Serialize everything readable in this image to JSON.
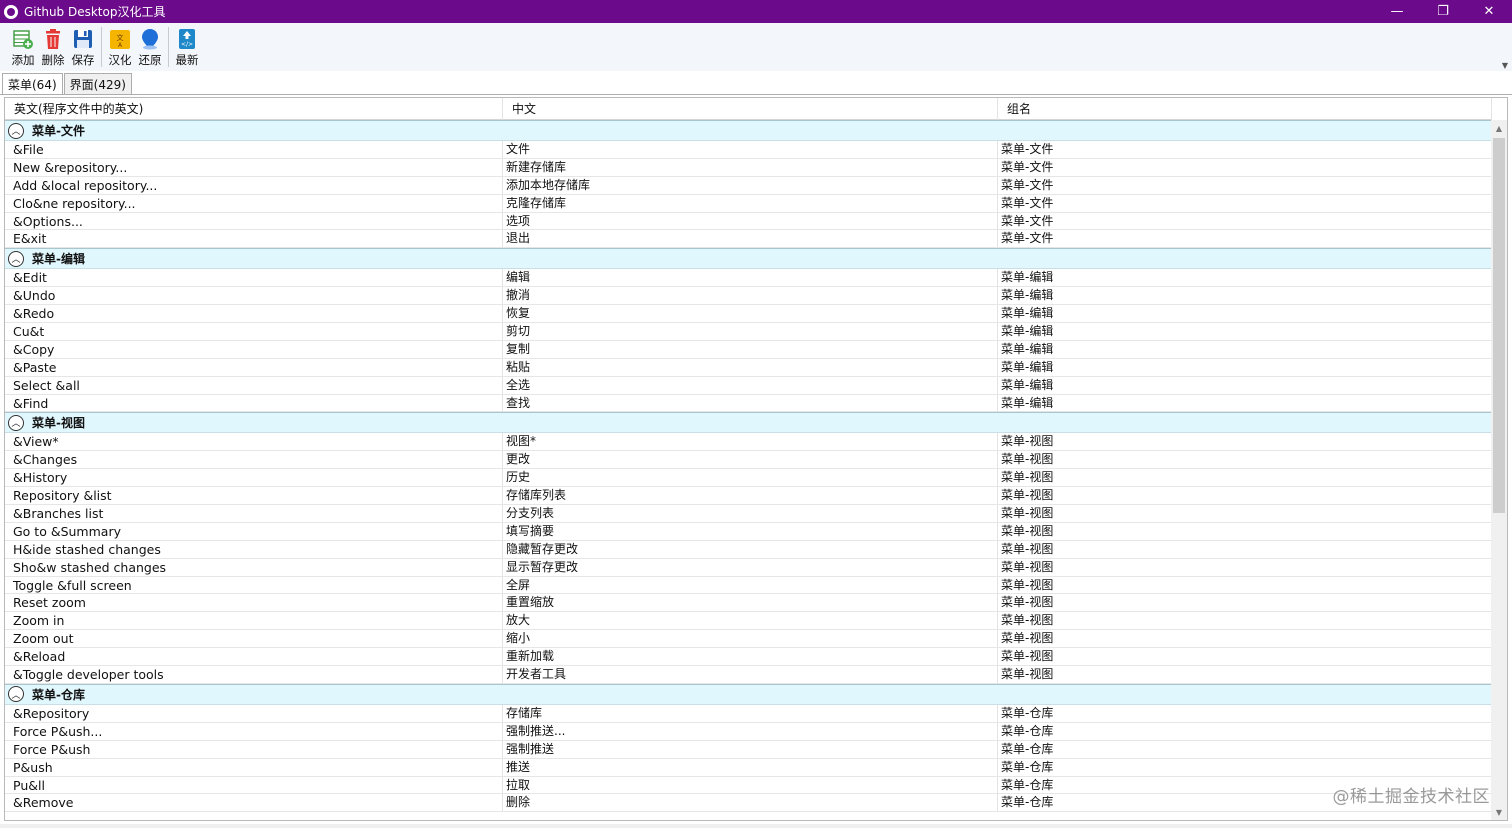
{
  "window": {
    "title": "Github Desktop汉化工具",
    "controls": [
      "—",
      "❐",
      "✕"
    ]
  },
  "toolbar": {
    "buttons": [
      {
        "label": "添加",
        "icon": "add-table-icon",
        "color": "#4caf50"
      },
      {
        "label": "删除",
        "icon": "trash-icon",
        "color": "#e53935"
      },
      {
        "label": "保存",
        "icon": "save-disk-icon",
        "color": "#1e5fb3"
      },
      {
        "label": "汉化",
        "icon": "translate-icon",
        "color": "#f5b400"
      },
      {
        "label": "还原",
        "icon": "restore-pin-icon",
        "color": "#1e6fd8"
      },
      {
        "label": "最新",
        "icon": "update-icon",
        "color": "#1e88c8"
      }
    ]
  },
  "tabs": [
    {
      "label": "菜单(64)",
      "active": true
    },
    {
      "label": "界面(429)",
      "active": false
    }
  ],
  "grid": {
    "headers": [
      "英文(程序文件中的英文)",
      "中文",
      "组名"
    ],
    "groups": [
      {
        "name": "菜单-文件",
        "rows": [
          [
            "&File",
            "文件",
            "菜单-文件"
          ],
          [
            "New &repository...",
            "新建存储库",
            "菜单-文件"
          ],
          [
            "Add &local repository...",
            "添加本地存储库",
            "菜单-文件"
          ],
          [
            "Clo&ne repository...",
            "克隆存储库",
            "菜单-文件"
          ],
          [
            "&Options...",
            "选项",
            "菜单-文件"
          ],
          [
            "E&xit",
            "退出",
            "菜单-文件"
          ]
        ]
      },
      {
        "name": "菜单-编辑",
        "rows": [
          [
            "&Edit",
            "编辑",
            "菜单-编辑"
          ],
          [
            "&Undo",
            "撤消",
            "菜单-编辑"
          ],
          [
            "&Redo",
            "恢复",
            "菜单-编辑"
          ],
          [
            "Cu&t",
            "剪切",
            "菜单-编辑"
          ],
          [
            "&Copy",
            "复制",
            "菜单-编辑"
          ],
          [
            "&Paste",
            "粘贴",
            "菜单-编辑"
          ],
          [
            "Select &all",
            "全选",
            "菜单-编辑"
          ],
          [
            "&Find",
            "查找",
            "菜单-编辑"
          ]
        ]
      },
      {
        "name": "菜单-视图",
        "rows": [
          [
            "&View*",
            "视图*",
            "菜单-视图"
          ],
          [
            "&Changes",
            "更改",
            "菜单-视图"
          ],
          [
            "&History",
            "历史",
            "菜单-视图"
          ],
          [
            "Repository &list",
            "存储库列表",
            "菜单-视图"
          ],
          [
            "&Branches list",
            "分支列表",
            "菜单-视图"
          ],
          [
            "Go to &Summary",
            "填写摘要",
            "菜单-视图"
          ],
          [
            "H&ide stashed changes",
            "隐藏暂存更改",
            "菜单-视图"
          ],
          [
            "Sho&w stashed changes",
            "显示暂存更改",
            "菜单-视图"
          ],
          [
            "Toggle &full screen",
            "全屏",
            "菜单-视图"
          ],
          [
            "Reset zoom",
            "重置缩放",
            "菜单-视图"
          ],
          [
            "Zoom in",
            "放大",
            "菜单-视图"
          ],
          [
            "Zoom out",
            "缩小",
            "菜单-视图"
          ],
          [
            "&Reload",
            "重新加载",
            "菜单-视图"
          ],
          [
            "&Toggle developer tools",
            "开发者工具",
            "菜单-视图"
          ]
        ]
      },
      {
        "name": "菜单-仓库",
        "rows": [
          [
            "&Repository",
            "存储库",
            "菜单-仓库"
          ],
          [
            "Force P&ush...",
            "强制推送...",
            "菜单-仓库"
          ],
          [
            "Force P&ush",
            "强制推送",
            "菜单-仓库"
          ],
          [
            "P&ush",
            "推送",
            "菜单-仓库"
          ],
          [
            "Pu&ll",
            "拉取",
            "菜单-仓库"
          ],
          [
            "&Remove",
            "删除",
            "菜单-仓库"
          ]
        ]
      }
    ]
  },
  "watermark": "@稀土掘金技术社区",
  "colors": {
    "titlebar": "#6b0a8a",
    "group_row": "#e0f7fd"
  }
}
